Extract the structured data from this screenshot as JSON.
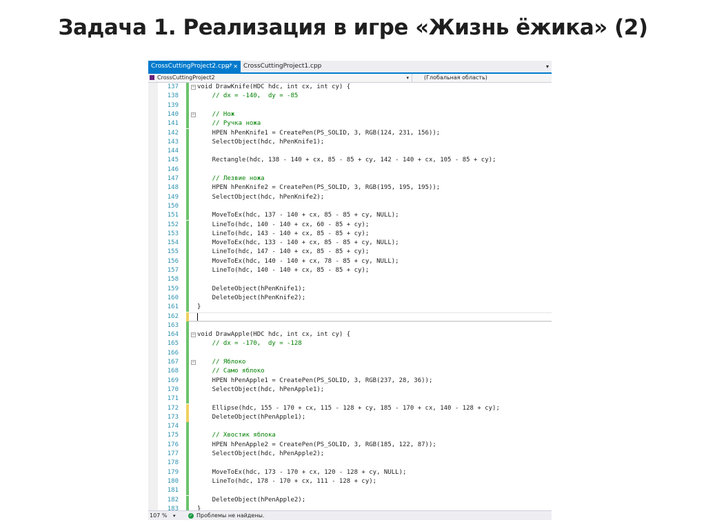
{
  "slide": {
    "title": "Задача 1. Реализация в игре «Жизнь ёжика» (2)"
  },
  "tabs": [
    {
      "label": "CrossCuttingProject2.cpp*",
      "pin": "⊹",
      "close": "✕",
      "active": true
    },
    {
      "label": "CrossCuttingProject1.cpp",
      "active": false
    }
  ],
  "tab_dropdown": "▾",
  "navbar": {
    "project": "CrossCuttingProject2",
    "arrow": "▾",
    "scope": "(Глобальная область)"
  },
  "status": {
    "zoom": "107 %",
    "zoom_arrow": "▾",
    "ok_glyph": "✓",
    "problems": "Проблемы не найдены."
  },
  "code_lines": [
    {
      "n": "137",
      "text": "void DrawKnife(HDC hdc, int cx, int cy) {",
      "fold": "−"
    },
    {
      "n": "138",
      "text": "    // dx = -140,  dy = -85",
      "kind": "comment"
    },
    {
      "n": "139",
      "text": ""
    },
    {
      "n": "140",
      "text": "    // Нож",
      "kind": "comment",
      "fold": "−"
    },
    {
      "n": "141",
      "text": "    // Ручка ножа",
      "kind": "comment"
    },
    {
      "n": "142",
      "text": "    HPEN hPenKnife1 = CreatePen(PS_SOLID, 3, RGB(124, 231, 156));"
    },
    {
      "n": "143",
      "text": "    SelectObject(hdc, hPenKnife1);"
    },
    {
      "n": "144",
      "text": ""
    },
    {
      "n": "145",
      "text": "    Rectangle(hdc, 138 - 140 + cx, 85 - 85 + cy, 142 - 140 + cx, 105 - 85 + cy);"
    },
    {
      "n": "146",
      "text": ""
    },
    {
      "n": "147",
      "text": "    // Лезвие ножа",
      "kind": "comment"
    },
    {
      "n": "148",
      "text": "    HPEN hPenKnife2 = CreatePen(PS_SOLID, 3, RGB(195, 195, 195));"
    },
    {
      "n": "149",
      "text": "    SelectObject(hdc, hPenKnife2);"
    },
    {
      "n": "150",
      "text": ""
    },
    {
      "n": "151",
      "text": "    MoveToEx(hdc, 137 - 140 + cx, 85 - 85 + cy, NULL);"
    },
    {
      "n": "152",
      "text": "    LineTo(hdc, 140 - 140 + cx, 60 - 85 + cy);"
    },
    {
      "n": "153",
      "text": "    LineTo(hdc, 143 - 140 + cx, 85 - 85 + cy);"
    },
    {
      "n": "154",
      "text": "    MoveToEx(hdc, 133 - 140 + cx, 85 - 85 + cy, NULL);"
    },
    {
      "n": "155",
      "text": "    LineTo(hdc, 147 - 140 + cx, 85 - 85 + cy);"
    },
    {
      "n": "156",
      "text": "    MoveToEx(hdc, 140 - 140 + cx, 78 - 85 + cy, NULL);"
    },
    {
      "n": "157",
      "text": "    LineTo(hdc, 140 - 140 + cx, 85 - 85 + cy);"
    },
    {
      "n": "158",
      "text": ""
    },
    {
      "n": "159",
      "text": "    DeleteObject(hPenKnife1);"
    },
    {
      "n": "160",
      "text": "    DeleteObject(hPenKnife2);"
    },
    {
      "n": "161",
      "text": "}"
    },
    {
      "n": "162",
      "text": "",
      "current": true
    },
    {
      "n": "163",
      "text": ""
    },
    {
      "n": "164",
      "text": "void DrawApple(HDC hdc, int cx, int cy) {",
      "fold": "−"
    },
    {
      "n": "165",
      "text": "    // dx = -170,  dy = -128",
      "kind": "comment"
    },
    {
      "n": "166",
      "text": ""
    },
    {
      "n": "167",
      "text": "    // Яблоко",
      "kind": "comment",
      "fold": "−"
    },
    {
      "n": "168",
      "text": "    // Само яблоко",
      "kind": "comment"
    },
    {
      "n": "169",
      "text": "    HPEN hPenApple1 = CreatePen(PS_SOLID, 3, RGB(237, 28, 36));"
    },
    {
      "n": "170",
      "text": "    SelectObject(hdc, hPenApple1);"
    },
    {
      "n": "171",
      "text": ""
    },
    {
      "n": "172",
      "text": "    Ellipse(hdc, 155 - 170 + cx, 115 - 128 + cy, 185 - 170 + cx, 140 - 128 + cy);",
      "unsaved": true
    },
    {
      "n": "173",
      "text": "    DeleteObject(hPenApple1);",
      "unsaved": true
    },
    {
      "n": "174",
      "text": ""
    },
    {
      "n": "175",
      "text": "    // Хвостик яблока",
      "kind": "comment"
    },
    {
      "n": "176",
      "text": "    HPEN hPenApple2 = CreatePen(PS_SOLID, 3, RGB(185, 122, 87));"
    },
    {
      "n": "177",
      "text": "    SelectObject(hdc, hPenApple2);"
    },
    {
      "n": "178",
      "text": ""
    },
    {
      "n": "179",
      "text": "    MoveToEx(hdc, 173 - 170 + cx, 120 - 128 + cy, NULL);"
    },
    {
      "n": "180",
      "text": "    LineTo(hdc, 178 - 170 + cx, 111 - 128 + cy);"
    },
    {
      "n": "181",
      "text": ""
    },
    {
      "n": "182",
      "text": "    DeleteObject(hPenApple2);"
    },
    {
      "n": "183",
      "text": "}"
    }
  ],
  "colors": {
    "accent_tab": "#007acc",
    "line_numbers": "#2b91af",
    "comment": "#008000",
    "keyword": "#0000ff",
    "change_saved": "#6cc36c",
    "change_unsaved": "#f0d060"
  }
}
